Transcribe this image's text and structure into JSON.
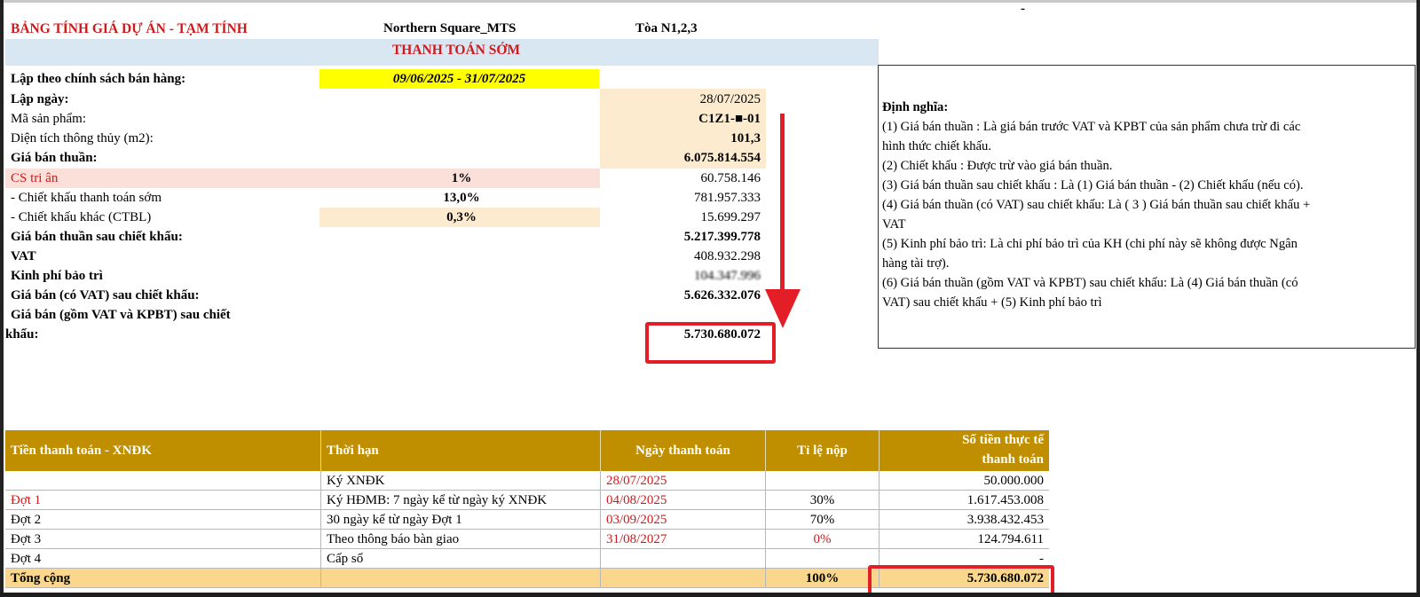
{
  "header": {
    "sheet_title": "BẢNG TÍNH GIÁ DỰ ÁN - TẠM TÍNH",
    "project": "Northern Square_MTS",
    "building": "Tòa N1,2,3",
    "banner": "THANH TOÁN SỚM",
    "dash": "-"
  },
  "summary": {
    "policy_label": "Lập theo chính sách bán hàng:",
    "policy_value": "09/06/2025 - 31/07/2025",
    "date_label": "Lập ngày:",
    "date_value": "28/07/2025",
    "product_label": "Mã sản phẩm:",
    "product_value": "C1Z1-■-01",
    "area_label": "Diện tích thông thủy (m2):",
    "area_value": "101,3",
    "net_price_label": "Giá bán thuần:",
    "net_price_value": "6.075.814.554",
    "cs_label": "CS tri ân",
    "cs_rate": "1%",
    "cs_value": "60.758.146",
    "early_label": "- Chiết khấu thanh toán sớm",
    "early_rate": "13,0%",
    "early_value": "781.957.333",
    "other_label": "- Chiết khấu khác (CTBL)",
    "other_rate": "0,3%",
    "other_value": "15.699.297",
    "after_disc_label": "Giá bán thuần sau chiết khấu:",
    "after_disc_value": "5.217.399.778",
    "vat_label": "VAT",
    "vat_value": "408.932.298",
    "maint_label": "Kinh phí bảo trì",
    "maint_value": "104.347.996",
    "with_vat_label": "Giá bán (có VAT) sau chiết khấu:",
    "with_vat_value": "5.626.332.076",
    "final_label_1": "Giá bán (gồm VAT và KPBT) sau chiết",
    "final_label_2": "khấu:",
    "final_value": "5.730.680.072"
  },
  "definitions": {
    "title": "Định nghĩa:",
    "lines": [
      "(1) Giá bán thuần : Là giá bán trước VAT và KPBT của sản phẩm chưa trừ đi các",
      "hình thức chiết khấu.",
      "(2) Chiết khấu : Được trừ vào giá bán thuần.",
      "(3) Giá bán thuần sau chiết khấu : Là (1) Giá bán thuần - (2) Chiết khấu (nếu có).",
      "(4) Giá bán thuần (có VAT) sau chiết khấu: Là ( 3 ) Giá bán thuần sau chiết khấu +",
      "VAT",
      "(5) Kinh phí bảo trì: Là chi phí bảo trì của KH (chi phí này sẽ không được Ngân",
      "hàng tài trợ).",
      "(6) Giá bán thuần (gồm VAT và KPBT) sau chiết khấu: Là (4) Giá bán thuần (có",
      "VAT) sau chiết khấu + (5) Kinh phí bảo trì"
    ]
  },
  "payment_table": {
    "headers": [
      "Tiền thanh toán - XNĐK",
      "Thời hạn",
      "Ngày thanh toán",
      "Tỉ lệ nộp",
      "Số tiền thực tế",
      "thanh toán"
    ],
    "rows": [
      {
        "name": "",
        "term": "Ký XNĐK",
        "date": "28/07/2025",
        "rate": "",
        "amount": "50.000.000"
      },
      {
        "name": "Đợt 1",
        "term": "Ký HĐMB: 7 ngày kể từ ngày ký XNĐK",
        "date": "04/08/2025",
        "rate": "30%",
        "amount": "1.617.453.008"
      },
      {
        "name": "Đợt 2",
        "term": "30 ngày kể từ ngày Đợt 1",
        "date": "03/09/2025",
        "rate": "70%",
        "amount": "3.938.432.453"
      },
      {
        "name": "Đợt 3",
        "term": "Theo thông báo bàn giao",
        "date": "31/08/2027",
        "rate": "0%",
        "amount": "124.794.611"
      },
      {
        "name": "Đợt 4",
        "term": "Cấp sổ",
        "date": "",
        "rate": "",
        "amount": "-"
      }
    ],
    "total": {
      "name": "Tổng cộng",
      "rate": "100%",
      "amount": "5.730.680.072"
    }
  },
  "colors": {
    "header_gold": "#bf8f00",
    "accent_red": "#e41e26",
    "highlight_yellow": "#ffff00",
    "total_row": "#fad78c"
  }
}
